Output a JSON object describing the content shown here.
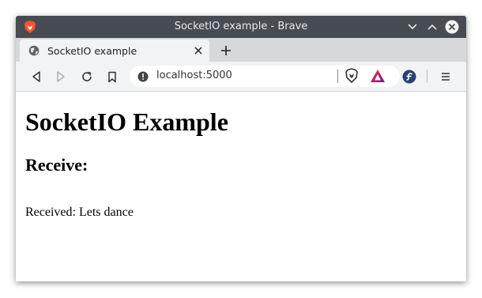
{
  "window": {
    "title": "SocketIO example - Brave"
  },
  "tabs": [
    {
      "label": "SocketIO  example"
    }
  ],
  "address_bar": {
    "url": "localhost:5000"
  },
  "page": {
    "heading": "SocketIO Example",
    "subheading": "Receive:",
    "received_label": "Received:",
    "received_message": "Lets dance"
  },
  "colors": {
    "titlebar": "#474b52",
    "brave_accent": "#fb542b",
    "toolbar": "#f1f3f4"
  },
  "icons": [
    "brave-logo-icon",
    "chevron-down-icon",
    "chevron-up-icon",
    "close-icon",
    "globe-icon",
    "tab-close-icon",
    "plus-icon",
    "back-icon",
    "forward-icon",
    "reload-icon",
    "bookmark-icon",
    "info-icon",
    "brave-shields-icon",
    "brave-rewards-icon",
    "fedora-extension-icon",
    "menu-icon"
  ]
}
